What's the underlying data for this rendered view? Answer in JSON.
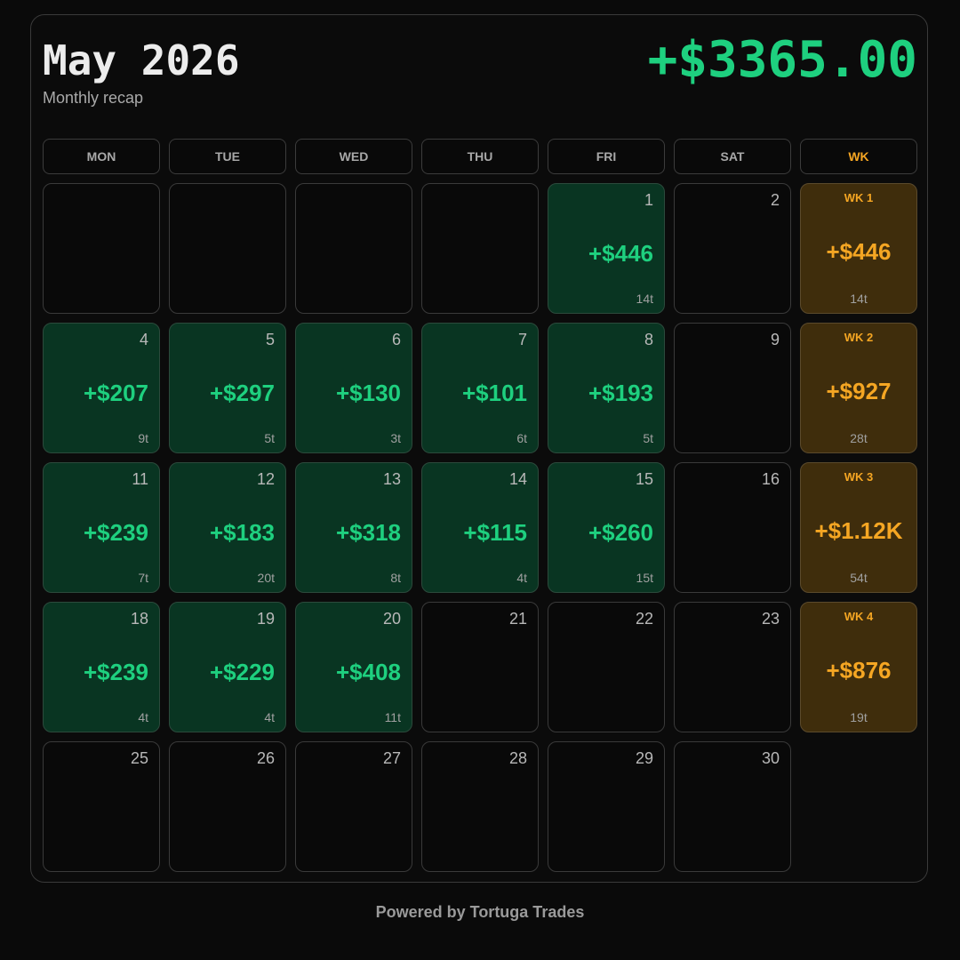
{
  "header": {
    "title": "May 2026",
    "subtitle": "Monthly recap",
    "total": "+$3365.00"
  },
  "weekday_headers": [
    "MON",
    "TUE",
    "WED",
    "THU",
    "FRI",
    "SAT",
    "WK"
  ],
  "weeks": [
    {
      "days": [
        {
          "day": "",
          "pnl": "",
          "trades": ""
        },
        {
          "day": "",
          "pnl": "",
          "trades": ""
        },
        {
          "day": "",
          "pnl": "",
          "trades": ""
        },
        {
          "day": "",
          "pnl": "",
          "trades": ""
        },
        {
          "day": "1",
          "pnl": "+$446",
          "trades": "14t"
        },
        {
          "day": "2",
          "pnl": "",
          "trades": ""
        }
      ],
      "summary": {
        "label": "WK 1",
        "pnl": "+$446",
        "trades": "14t"
      }
    },
    {
      "days": [
        {
          "day": "4",
          "pnl": "+$207",
          "trades": "9t"
        },
        {
          "day": "5",
          "pnl": "+$297",
          "trades": "5t"
        },
        {
          "day": "6",
          "pnl": "+$130",
          "trades": "3t"
        },
        {
          "day": "7",
          "pnl": "+$101",
          "trades": "6t"
        },
        {
          "day": "8",
          "pnl": "+$193",
          "trades": "5t"
        },
        {
          "day": "9",
          "pnl": "",
          "trades": ""
        }
      ],
      "summary": {
        "label": "WK 2",
        "pnl": "+$927",
        "trades": "28t"
      }
    },
    {
      "days": [
        {
          "day": "11",
          "pnl": "+$239",
          "trades": "7t"
        },
        {
          "day": "12",
          "pnl": "+$183",
          "trades": "20t"
        },
        {
          "day": "13",
          "pnl": "+$318",
          "trades": "8t"
        },
        {
          "day": "14",
          "pnl": "+$115",
          "trades": "4t"
        },
        {
          "day": "15",
          "pnl": "+$260",
          "trades": "15t"
        },
        {
          "day": "16",
          "pnl": "",
          "trades": ""
        }
      ],
      "summary": {
        "label": "WK 3",
        "pnl": "+$1.12K",
        "trades": "54t"
      }
    },
    {
      "days": [
        {
          "day": "18",
          "pnl": "+$239",
          "trades": "4t"
        },
        {
          "day": "19",
          "pnl": "+$229",
          "trades": "4t"
        },
        {
          "day": "20",
          "pnl": "+$408",
          "trades": "11t"
        },
        {
          "day": "21",
          "pnl": "",
          "trades": ""
        },
        {
          "day": "22",
          "pnl": "",
          "trades": ""
        },
        {
          "day": "23",
          "pnl": "",
          "trades": ""
        }
      ],
      "summary": {
        "label": "WK 4",
        "pnl": "+$876",
        "trades": "19t"
      }
    },
    {
      "days": [
        {
          "day": "25",
          "pnl": "",
          "trades": ""
        },
        {
          "day": "26",
          "pnl": "",
          "trades": ""
        },
        {
          "day": "27",
          "pnl": "",
          "trades": ""
        },
        {
          "day": "28",
          "pnl": "",
          "trades": ""
        },
        {
          "day": "29",
          "pnl": "",
          "trades": ""
        },
        {
          "day": "30",
          "pnl": "",
          "trades": ""
        }
      ],
      "summary": null
    }
  ],
  "footer": "Powered by Tortuga Trades",
  "colors": {
    "background": "#0a0a0a",
    "profit_text": "#1ed07f",
    "profit_cell": "#093522",
    "week_text": "#f5a623",
    "week_cell": "#3f2d0c",
    "border": "#3a3a3a"
  }
}
